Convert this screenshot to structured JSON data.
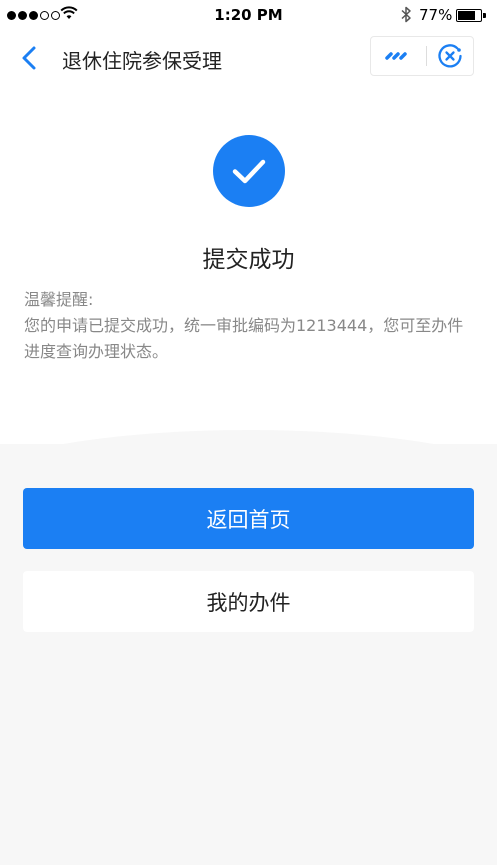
{
  "status_bar": {
    "time": "1:20 PM",
    "battery_percent": "77%",
    "battery_level": 0.77,
    "signal_bars_filled": 3,
    "signal_bars_total": 5
  },
  "nav": {
    "title": "退休住院参保受理",
    "back_icon": "chevron-left-icon",
    "more_icon": "more-dots-icon",
    "close_icon": "close-circle-icon"
  },
  "result": {
    "icon": "check-circle-icon",
    "title": "提交成功",
    "notice_heading": "温馨提醒:",
    "notice_body": "您的申请已提交成功，统一审批编码为1213444，您可至办件进度查询办理状态。"
  },
  "actions": {
    "home_label": "返回首页",
    "my_items_label": "我的办件"
  },
  "colors": {
    "accent": "#1b7ff3",
    "background": "#f7f7f7"
  }
}
